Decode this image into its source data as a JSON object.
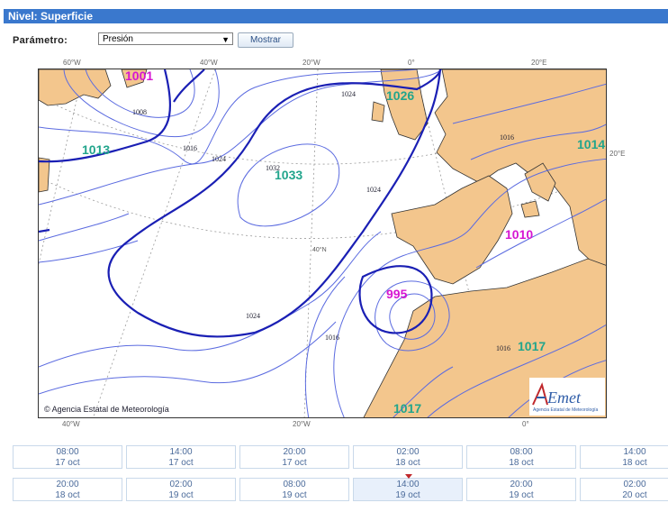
{
  "header": {
    "title": "Nivel: Superficie"
  },
  "controls": {
    "param_label": "Parámetro:",
    "param_value": "Presión",
    "show_button": "Mostrar"
  },
  "map": {
    "lon_top": [
      "60°W",
      "40°W",
      "20°W",
      "0°",
      "20°E"
    ],
    "lon_bottom": [
      "40°W",
      "20°W",
      "0°"
    ],
    "lat_labels": [
      "40°N"
    ],
    "side_label": "20°E",
    "isobar_labels": [
      "1008",
      "1016",
      "1024",
      "1032",
      "1024",
      "1024",
      "1024",
      "1016",
      "1016",
      "1016"
    ],
    "centers_magenta": [
      "1001",
      "1010",
      "995"
    ],
    "centers_green": [
      "1026",
      "1013",
      "1033",
      "1014",
      "1017",
      "1017"
    ],
    "copyright": "© Agencia Estatal de Meteorología",
    "logo_text": "AEmet",
    "logo_sub": "Agencia Estatal de Meteorología",
    "colors": {
      "land": "#f3c68d",
      "isobar": "#5b6be0",
      "isobar_bold": "#1a1fb4",
      "low": "#d616d2",
      "high": "#22a58c"
    }
  },
  "timeline": [
    {
      "time": "08:00",
      "date": "17 oct"
    },
    {
      "time": "14:00",
      "date": "17 oct"
    },
    {
      "time": "20:00",
      "date": "17 oct"
    },
    {
      "time": "02:00",
      "date": "18 oct"
    },
    {
      "time": "08:00",
      "date": "18 oct"
    },
    {
      "time": "14:00",
      "date": "18 oct"
    },
    {
      "time": "20:00",
      "date": "18 oct"
    },
    {
      "time": "02:00",
      "date": "19 oct"
    },
    {
      "time": "08:00",
      "date": "19 oct"
    },
    {
      "time": "14:00",
      "date": "19 oct"
    },
    {
      "time": "20:00",
      "date": "19 oct"
    },
    {
      "time": "02:00",
      "date": "20 oct"
    }
  ],
  "selected_index": 9
}
